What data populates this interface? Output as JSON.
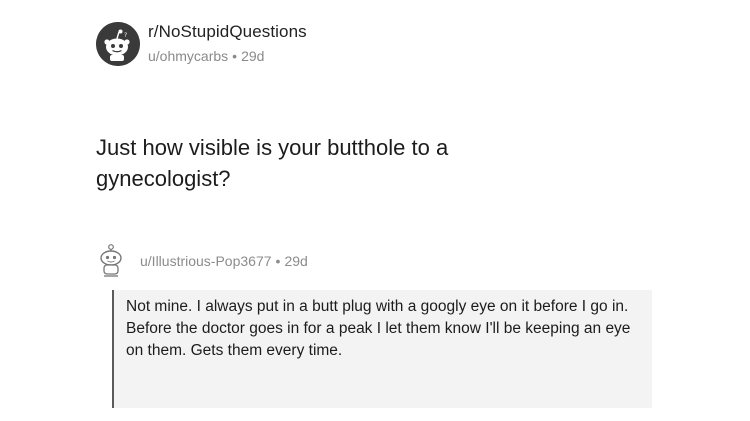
{
  "post": {
    "subreddit": "r/NoStupidQuestions",
    "author": "u/ohmycarbs",
    "separator": "•",
    "age": "29d",
    "title": "Just how visible is your butthole to a gynecologist?"
  },
  "comment": {
    "author": "u/Illustrious-Pop3677",
    "separator": "•",
    "age": "29d",
    "body": "Not mine. I always put in a butt plug with a googly eye on it before I go in. Before the doctor goes in for a peak I let them know I'll be keeping an eye on them. Gets them every time."
  },
  "icons": {
    "subreddit_avatar": "reddit-snoo-icon",
    "comment_avatar": "snoo-avatar-icon"
  }
}
